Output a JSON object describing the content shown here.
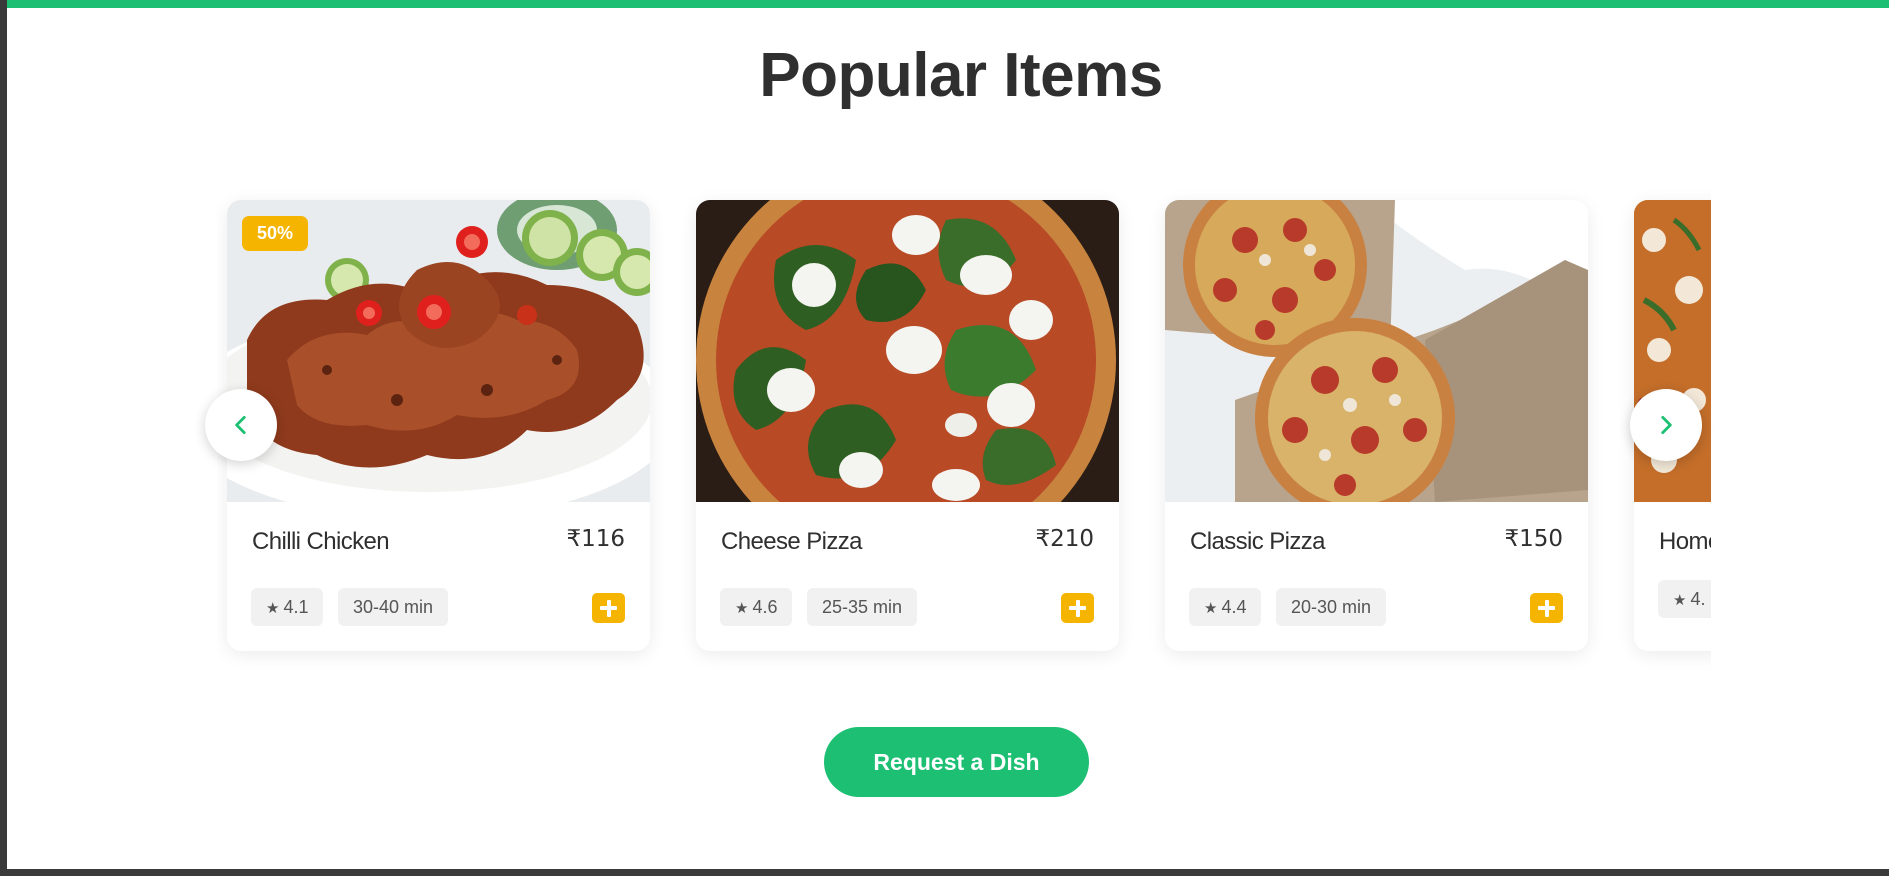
{
  "section": {
    "title": "Popular Items"
  },
  "colors": {
    "accent": "#1dbf73",
    "badge": "#f4b400",
    "text": "#2f2f2f"
  },
  "carousel": {
    "prev_icon": "chevron-left-icon",
    "next_icon": "chevron-right-icon",
    "items": [
      {
        "name": "Chilli Chicken",
        "price": "₹116",
        "rating": "4.1",
        "time": "30-40 min",
        "discount": "50%",
        "image": "chilli-chicken-photo"
      },
      {
        "name": "Cheese Pizza",
        "price": "₹210",
        "rating": "4.6",
        "time": "25-35 min",
        "image": "cheese-pizza-photo"
      },
      {
        "name": "Classic Pizza",
        "price": "₹150",
        "rating": "4.4",
        "time": "20-30 min",
        "image": "classic-pizza-photo"
      },
      {
        "name": "Home",
        "rating": "4.",
        "image": "partial-pizza-photo"
      }
    ]
  },
  "actions": {
    "request_label": "Request a Dish"
  },
  "icons": {
    "star": "★",
    "add": "plus-icon"
  }
}
